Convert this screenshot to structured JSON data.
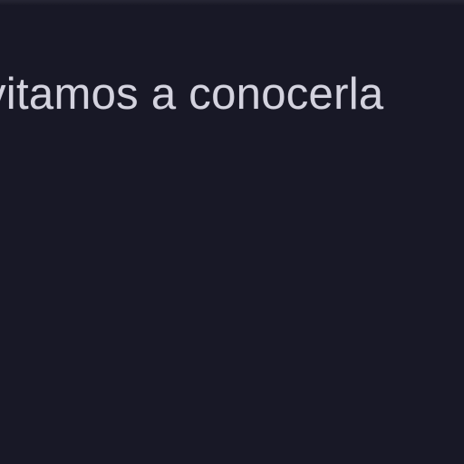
{
  "content": {
    "text_visible": "vitamos a conocerla",
    "colors": {
      "background": "#181826",
      "text": "#d4d3df"
    }
  }
}
